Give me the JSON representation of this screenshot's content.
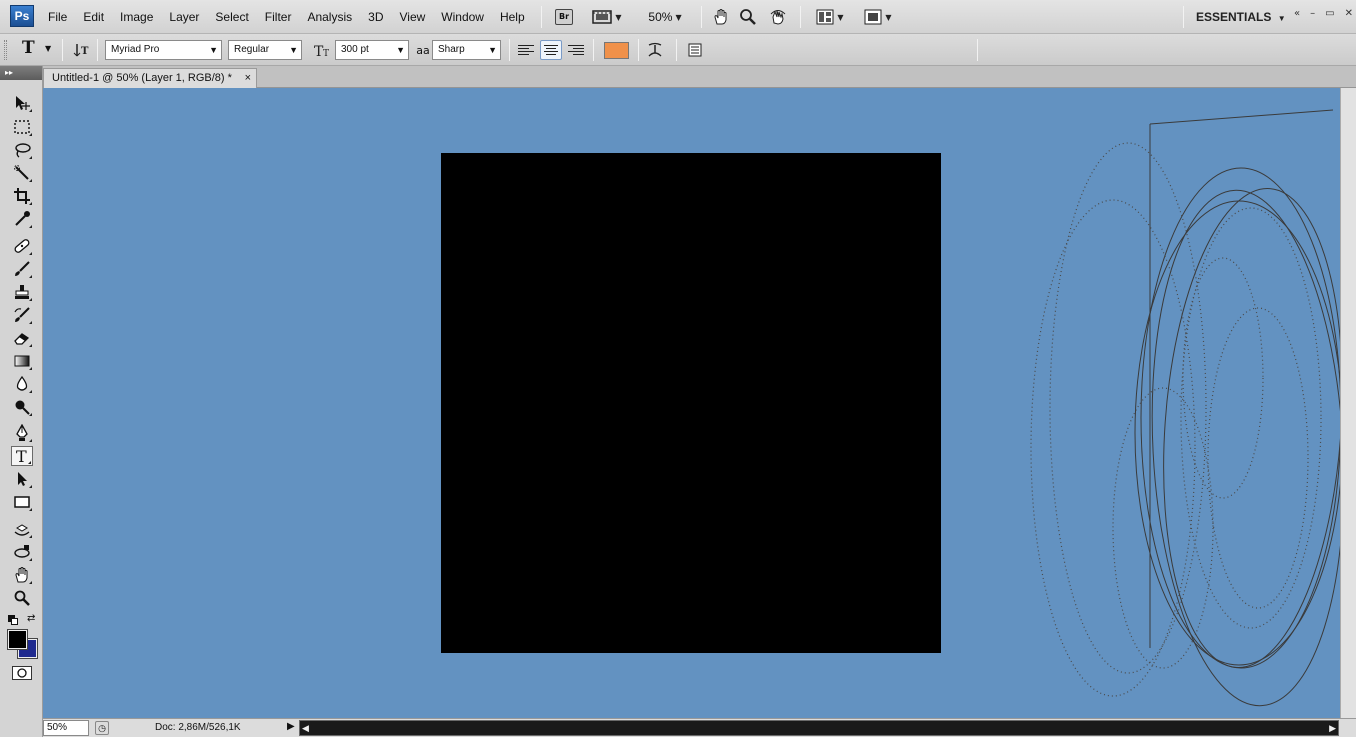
{
  "app": {
    "logo": "Ps"
  },
  "menu": [
    "File",
    "Edit",
    "Image",
    "Layer",
    "Select",
    "Filter",
    "Analysis",
    "3D",
    "View",
    "Window",
    "Help"
  ],
  "menubar": {
    "bridge_badge": "Br",
    "zoom": "50%",
    "workspace": "ESSENTIALS",
    "window_controls": [
      "«",
      "–",
      "▭",
      "✕"
    ]
  },
  "options": {
    "font_family": "Myriad Pro",
    "font_style": "Regular",
    "font_size": "300 pt",
    "aa_icon": "aa",
    "antialias": "Sharp",
    "text_color": "#f0914a"
  },
  "tab": {
    "title": "Untitled-1 @ 50% (Layer 1, RGB/8) *",
    "close": "×"
  },
  "tools_header": "▸▸",
  "tools": [
    "move-icon",
    "marquee-icon",
    "lasso-icon",
    "quick-select-icon",
    "crop-icon",
    "eyedropper-icon",
    "healing-icon",
    "brush-icon",
    "clone-stamp-icon",
    "history-brush-icon",
    "eraser-icon",
    "gradient-icon",
    "blur-icon",
    "dodge-icon",
    "pen-icon",
    "type-icon",
    "path-select-icon",
    "shape-icon",
    "3d-rotate-icon",
    "3d-orbit-icon",
    "hand-icon",
    "zoom-icon",
    "quick-mask-icon"
  ],
  "colors": {
    "canvas_bg": "#6392c1",
    "document": "#000000",
    "foreground": "#000000",
    "background": "#1f2a8f"
  },
  "status": {
    "zoom": "50%",
    "doc": "Doc: 2,86M/526,1K",
    "arrow": "▶"
  }
}
